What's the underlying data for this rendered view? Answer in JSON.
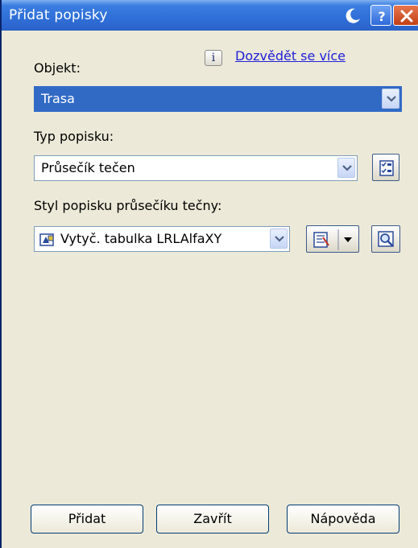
{
  "window": {
    "title": "Přidat popisky"
  },
  "object": {
    "label": "Objekt:",
    "value": "Trasa",
    "learn_more": "Dozvědět se více"
  },
  "label_type": {
    "label": "Typ popisku:",
    "value": "Průsečík tečen"
  },
  "label_style": {
    "label": "Styl popisku průsečíku tečny:",
    "value": "Vytyč. tabulka LRLAlfaXY"
  },
  "buttons": {
    "add": "Přidat",
    "close": "Zavřít",
    "help": "Nápověda"
  },
  "icons": {
    "titlebar": [
      "moon-icon",
      "help-icon",
      "close-icon"
    ],
    "info": "info-icon",
    "label_type_edit": "checklist-icon",
    "style_edit": "style-edit-icon",
    "style_preview": "magnifier-icon"
  },
  "colors": {
    "titlebar": "#2f6fd8",
    "selection": "#316ac5",
    "link": "#2020d8",
    "close": "#c33f14"
  }
}
